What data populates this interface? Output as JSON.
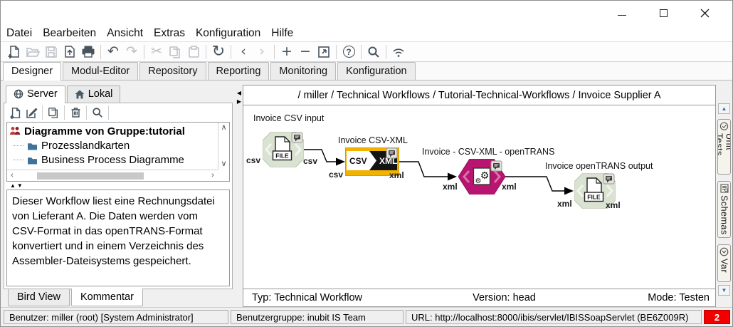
{
  "menu_bar": {
    "items": [
      "Datei",
      "Bearbeiten",
      "Ansicht",
      "Extras",
      "Konfiguration",
      "Hilfe"
    ]
  },
  "toolbar": {
    "glyphs": {
      "undo": "↶",
      "redo": "↷",
      "cut": "✂",
      "refresh": "↻",
      "back": "‹",
      "forward": "›",
      "zoom_in": "+",
      "zoom_out": "−",
      "help": "?"
    },
    "disabled_items": [
      "open-folder",
      "save",
      "redo",
      "cut",
      "copy",
      "paste",
      "forward"
    ]
  },
  "main_tabs": {
    "items": [
      "Designer",
      "Modul-Editor",
      "Repository",
      "Reporting",
      "Monitoring",
      "Konfiguration"
    ],
    "active": "Designer"
  },
  "left_panel": {
    "tabs": {
      "server": "Server",
      "lokal": "Lokal"
    },
    "tree": {
      "root": "Diagramme von Gruppe:tutorial",
      "items": [
        "Prozesslandkarten",
        "Business Process Diagramme"
      ]
    },
    "comment": "Dieser Workflow liest eine Rechnungsdatei von Lieferant A. Die Daten werden vom CSV-Format in das openTRANS-Format konvertiert und in einem Verzeichnis des Assembler-Dateisystems gespeichert.",
    "bottom_tabs": {
      "bird_view": "Bird View",
      "kommentar": "Kommentar"
    }
  },
  "canvas": {
    "breadcrumb": "/ miller / Technical Workflows / Tutorial-Technical-Workflows / Invoice Supplier A",
    "nodes": [
      {
        "label": "Invoice CSV input",
        "type": "file-connector",
        "in_port": "csv",
        "out_port": "csv",
        "file_label": "FILE"
      },
      {
        "label": "Invoice CSV-XML",
        "type": "csv-xml-converter",
        "in_port": "csv",
        "out_port": "xml",
        "left_text": "CSV",
        "right_text": "XML"
      },
      {
        "label": "Invoice - CSV-XML - openTRANS",
        "type": "xslt-converter",
        "in_port": "xml",
        "out_port": "xml",
        "gear_glyph": "⚙"
      },
      {
        "label": "Invoice openTRANS output",
        "type": "file-connector",
        "in_port": "xml",
        "out_port": "xml",
        "file_label": "FILE"
      }
    ],
    "footer": {
      "typ": "Typ: Technical Workflow",
      "version": "Version: head",
      "mode": "Mode: Testen"
    }
  },
  "right_tabs": {
    "items": [
      "Unit Tests",
      "Schemas",
      "Var"
    ]
  },
  "status_bar": {
    "user": "Benutzer: miller (root) [System Administrator]",
    "group": "Benutzergruppe: inubit IS Team",
    "url": "URL: http://localhost:8000/ibis/servlet/IBISSoapServlet (BE6Z009R)",
    "badge": "2"
  },
  "icons": {
    "up_triangle": "▲",
    "down_triangle": "▼",
    "left_triangle": "◀",
    "right_triangle": "▶",
    "chevron_up": "∧",
    "chevron_down": "∨",
    "chevron_left": "‹",
    "chevron_right": "›"
  },
  "colors": {
    "node_green": "#dae2d2",
    "node_yellow": "#f2b200",
    "node_magenta": "#b81470",
    "badge_red": "#f20000",
    "scroll_blue": "#3f68b0"
  }
}
